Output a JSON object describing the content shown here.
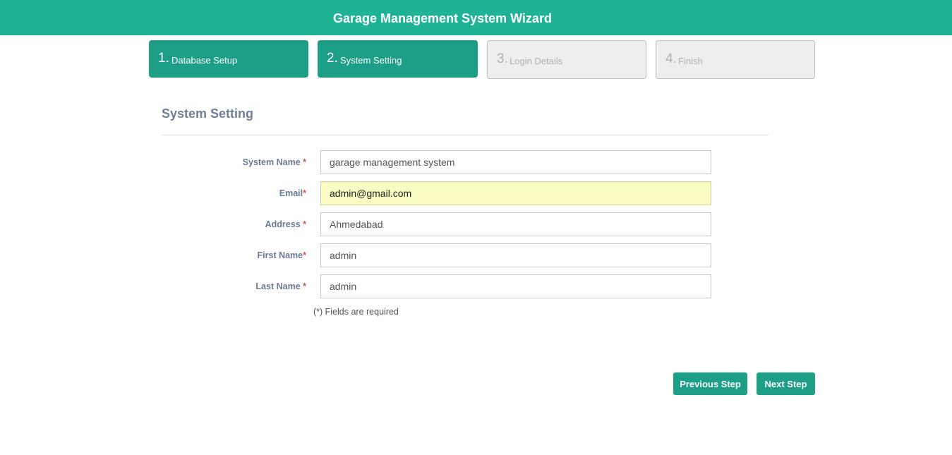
{
  "header": {
    "title": "Garage Management System Wizard"
  },
  "steps": [
    {
      "number": "1.",
      "label": "Database Setup",
      "state": "done"
    },
    {
      "number": "2.",
      "label": "System Setting",
      "state": "active"
    },
    {
      "number": "3.",
      "label": "Login Details",
      "state": "todo"
    },
    {
      "number": "4.",
      "label": "Finish",
      "state": "todo"
    }
  ],
  "section": {
    "title": "System Setting"
  },
  "form": {
    "fields": [
      {
        "label": "System Name ",
        "required_mark": "*",
        "value": "garage management system"
      },
      {
        "label": "Email",
        "required_mark": "*",
        "value": "admin@gmail.com"
      },
      {
        "label": "Address ",
        "required_mark": "*",
        "value": "Ahmedabad"
      },
      {
        "label": "First Name",
        "required_mark": "*",
        "value": "admin"
      },
      {
        "label": "Last Name ",
        "required_mark": "*",
        "value": "admin"
      }
    ],
    "required_note": "(*) Fields are required"
  },
  "buttons": {
    "previous": "Previous Step",
    "next": "Next Step"
  },
  "colors": {
    "header": "#1fb396",
    "step_active": "#1c9e87",
    "step_inactive": "#eeeeee",
    "label": "#6b7a96",
    "required": "#d9534f",
    "autofill": "#fafcc4"
  }
}
